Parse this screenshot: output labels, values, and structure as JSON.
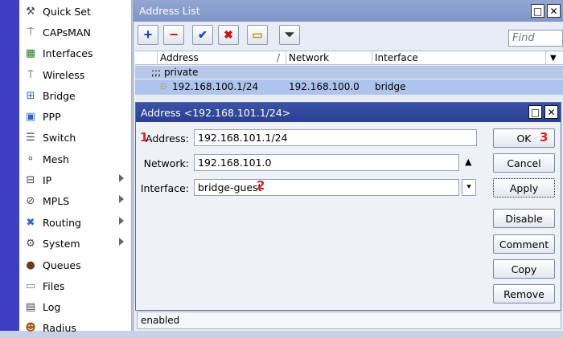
{
  "sidebar": {
    "items": [
      {
        "label": "Quick Set",
        "icon": "quick-set-icon",
        "glyph": "⚒",
        "submenu": false
      },
      {
        "label": "CAPsMAN",
        "icon": "antenna-icon",
        "glyph": "⍑",
        "submenu": false
      },
      {
        "label": "Interfaces",
        "icon": "interfaces-icon",
        "glyph": "▦",
        "submenu": false
      },
      {
        "label": "Wireless",
        "icon": "wireless-icon",
        "glyph": "⍑",
        "submenu": false
      },
      {
        "label": "Bridge",
        "icon": "bridge-icon",
        "glyph": "⊞",
        "submenu": false
      },
      {
        "label": "PPP",
        "icon": "ppp-icon",
        "glyph": "▣",
        "submenu": false
      },
      {
        "label": "Switch",
        "icon": "switch-icon",
        "glyph": "☰",
        "submenu": false
      },
      {
        "label": "Mesh",
        "icon": "mesh-icon",
        "glyph": "⚬",
        "submenu": false
      },
      {
        "label": "IP",
        "icon": "ip-icon",
        "glyph": "⊟",
        "submenu": true
      },
      {
        "label": "MPLS",
        "icon": "mpls-icon",
        "glyph": "⊘",
        "submenu": true
      },
      {
        "label": "Routing",
        "icon": "routing-icon",
        "glyph": "✖",
        "submenu": true
      },
      {
        "label": "System",
        "icon": "gear-icon",
        "glyph": "⚙",
        "submenu": true
      },
      {
        "label": "Queues",
        "icon": "queues-icon",
        "glyph": "●",
        "submenu": false
      },
      {
        "label": "Files",
        "icon": "folder-icon",
        "glyph": "▭",
        "submenu": false
      },
      {
        "label": "Log",
        "icon": "log-icon",
        "glyph": "▤",
        "submenu": false
      },
      {
        "label": "Radius",
        "icon": "radius-icon",
        "glyph": "☻",
        "submenu": false
      }
    ]
  },
  "list_window": {
    "title": "Address List",
    "restore_glyph": "□",
    "close_glyph": "✕",
    "find_placeholder": "Find",
    "toolbar": {
      "add": "+",
      "remove": "−",
      "enable": "✔",
      "disable": "✖",
      "comment": "▭",
      "filter": "⏷"
    },
    "columns": [
      "Address",
      "Network",
      "Interface"
    ],
    "sort_glyph": "/",
    "dropdown_glyph": "▼",
    "group_label": ";;; private",
    "rows": [
      {
        "address": "192.168.100.1/24",
        "network": "192.168.100.0",
        "interface": "bridge"
      }
    ],
    "status": "enabled"
  },
  "dialog": {
    "title": "Address <192.168.101.1/24>",
    "restore_glyph": "□",
    "close_glyph": "✕",
    "fields": {
      "address_label": "Address:",
      "address_value": "192.168.101.1/24",
      "network_label": "Network:",
      "network_value": "192.168.101.0",
      "interface_label": "Interface:",
      "interface_value": "bridge-guest"
    },
    "network_arrow": "▲",
    "interface_dropdown": "⯆",
    "buttons": {
      "ok": "OK",
      "cancel": "Cancel",
      "apply": "Apply",
      "disable": "Disable",
      "comment": "Comment",
      "copy": "Copy",
      "remove": "Remove"
    },
    "badges": {
      "one": "1",
      "two": "2",
      "three": "3"
    }
  },
  "colors": {
    "accent_strip": "#3e3ec2",
    "dialog_title": "#2a3f92",
    "badge_red": "#e02020",
    "add_blue": "#1a3fd0",
    "remove_red": "#c41818"
  }
}
